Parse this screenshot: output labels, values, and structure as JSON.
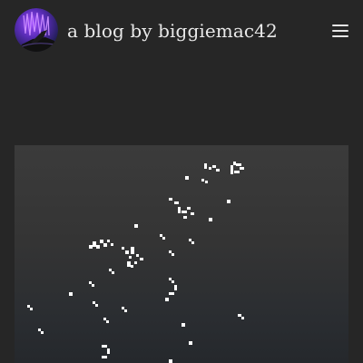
{
  "header": {
    "title": "a blog by biggiemac42"
  }
}
